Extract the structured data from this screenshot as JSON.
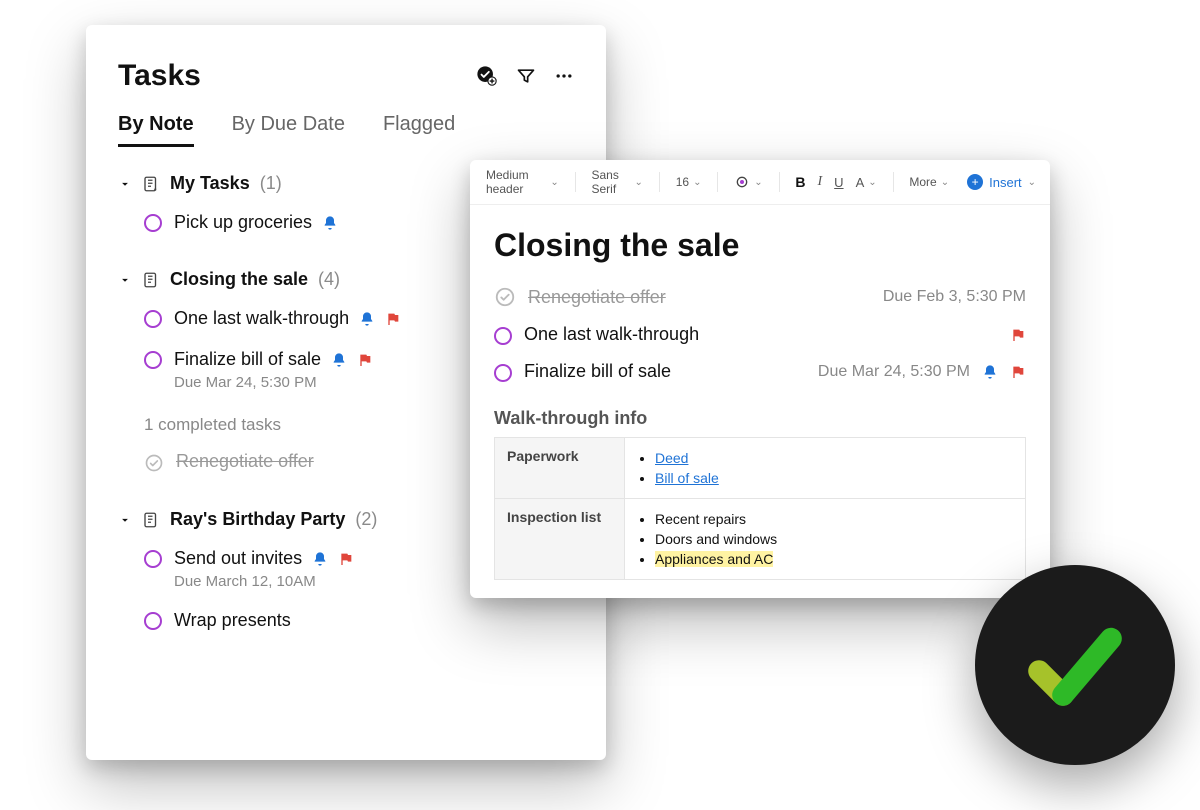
{
  "tasks_panel": {
    "title": "Tasks",
    "tabs": [
      "By Note",
      "By Due Date",
      "Flagged"
    ],
    "active_tab_index": 0,
    "sections": [
      {
        "name": "My Tasks",
        "count": "(1)",
        "items": [
          {
            "text": "Pick up groceries",
            "bell": true,
            "flag": false
          }
        ]
      },
      {
        "name": "Closing the sale",
        "count": "(4)",
        "items": [
          {
            "text": "One last walk-through",
            "bell": true,
            "flag": true
          },
          {
            "text": "Finalize bill of sale",
            "bell": true,
            "flag": true,
            "meta": "Due Mar 24, 5:30 PM"
          }
        ],
        "completed_label": "1 completed tasks",
        "completed_items": [
          {
            "text": "Renegotiate offer"
          }
        ]
      },
      {
        "name": "Ray's Birthday Party",
        "count": "(2)",
        "items": [
          {
            "text": "Send out invites",
            "bell": true,
            "flag": true,
            "meta": "Due March 12, 10AM"
          },
          {
            "text": "Wrap presents"
          }
        ]
      }
    ]
  },
  "note_panel": {
    "toolbar": {
      "style": "Medium header",
      "font": "Sans Serif",
      "size": "16",
      "more": "More",
      "insert": "Insert"
    },
    "title": "Closing the sale",
    "tasks": [
      {
        "text": "Renegotiate offer",
        "done": true,
        "due": "Due Feb 3, 5:30 PM"
      },
      {
        "text": "One last walk-through",
        "flag": true
      },
      {
        "text": "Finalize bill of sale",
        "due": "Due Mar 24, 5:30 PM",
        "bell": true,
        "flag": true
      }
    ],
    "subheading": "Walk-through info",
    "table": {
      "rows": [
        {
          "label": "Paperwork",
          "items": [
            {
              "text": "Deed",
              "link": true
            },
            {
              "text": "Bill of sale",
              "link": true
            }
          ]
        },
        {
          "label": "Inspection list",
          "items": [
            {
              "text": "Recent repairs"
            },
            {
              "text": "Doors and windows"
            },
            {
              "text": "Appliances and AC",
              "highlight": true
            }
          ]
        }
      ]
    }
  },
  "colors": {
    "accent_purple": "#a63ed1",
    "accent_blue": "#1f73d6",
    "accent_red": "#e0463b",
    "badge_bg": "#1b1b1b",
    "check_green": "#2eb927",
    "check_olive": "#a6c22a"
  }
}
